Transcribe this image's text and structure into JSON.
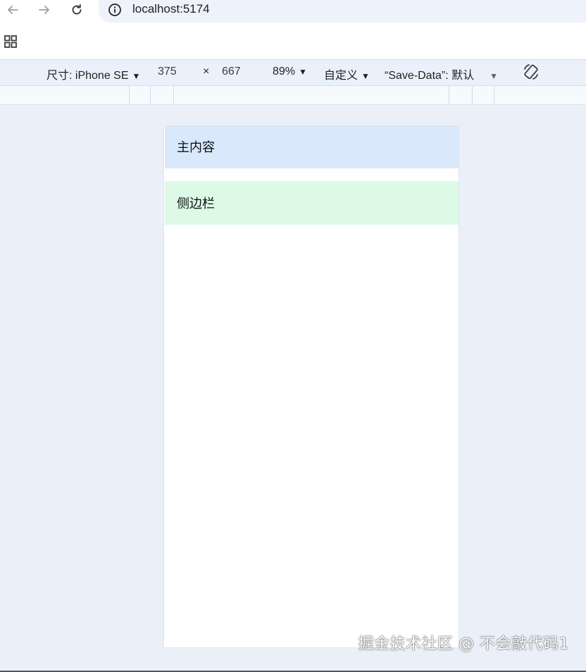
{
  "browser": {
    "url": "localhost:5174"
  },
  "devtools": {
    "device_label": "尺寸: iPhone SE",
    "width": "375",
    "times": "×",
    "height": "667",
    "zoom": "89%",
    "throttle": "自定义",
    "save_data_label": "“Save-Data”:",
    "save_data_value": "默认"
  },
  "page": {
    "main_content": "主内容",
    "sidebar": "侧边栏"
  },
  "watermark": "掘金技术社区 @ 不会敲代码1",
  "icons": {
    "back": "arrow-left-icon",
    "forward": "arrow-right-icon",
    "reload": "reload-icon",
    "info": "info-icon",
    "apps": "apps-grid-icon",
    "rotate": "rotate-icon"
  },
  "colors": {
    "main_bg": "#dae8fc",
    "side_bg": "#dcfae6",
    "stage_bg": "#eaeff8"
  }
}
